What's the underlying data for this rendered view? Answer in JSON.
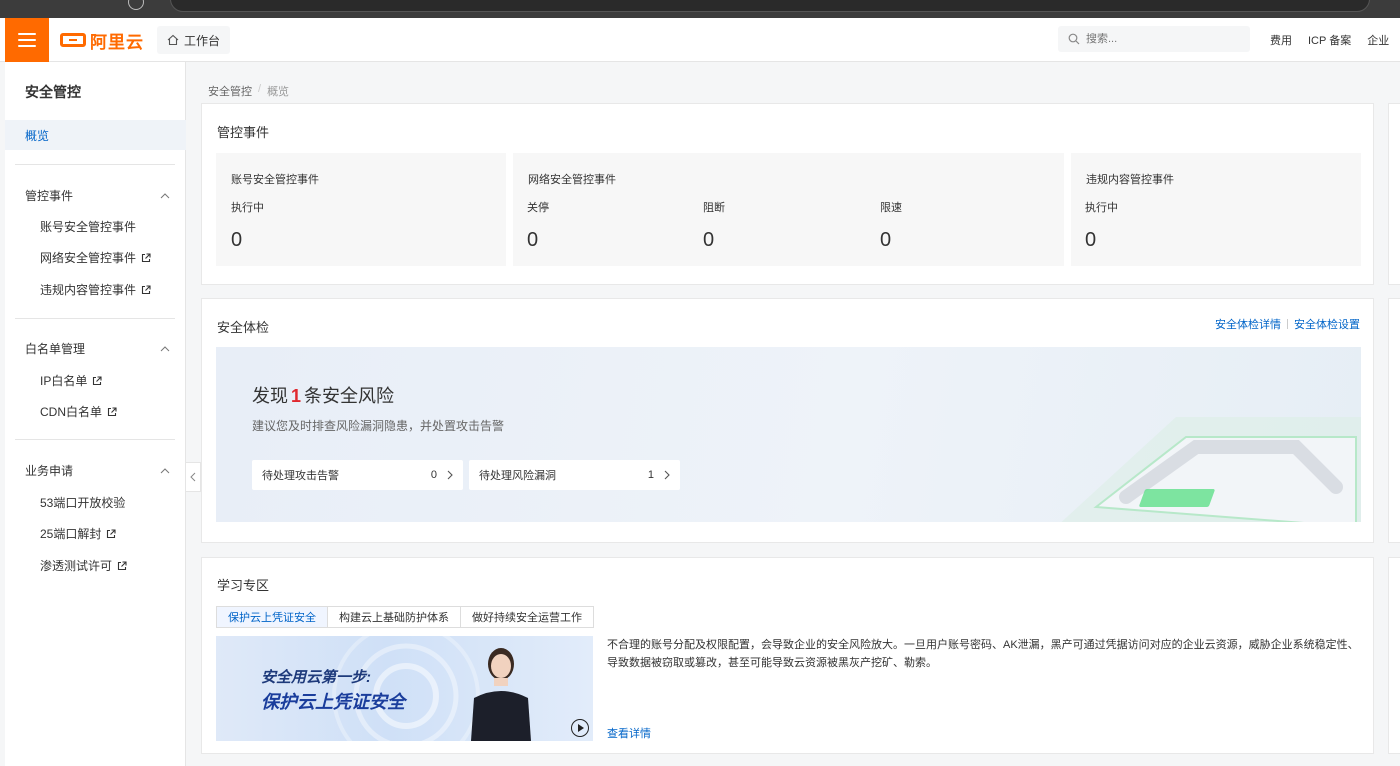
{
  "header": {
    "logo_text": "阿里云",
    "workbench": "工作台",
    "search_placeholder": "搜索...",
    "links": [
      "费用",
      "ICP 备案",
      "企业"
    ]
  },
  "sidebar": {
    "title": "安全管控",
    "active": "概览",
    "groups": [
      {
        "label": "管控事件",
        "items": [
          "账号安全管控事件",
          "网络安全管控事件",
          "违规内容管控事件"
        ]
      },
      {
        "label": "白名单管理",
        "items": [
          "IP白名单",
          "CDN白名单"
        ]
      },
      {
        "label": "业务申请",
        "items": [
          "53端口开放校验",
          "25端口解封",
          "渗透测试许可"
        ]
      }
    ]
  },
  "breadcrumb": {
    "root": "安全管控",
    "current": "概览"
  },
  "events": {
    "title": "管控事件",
    "account": {
      "title": "账号安全管控事件",
      "label": "执行中",
      "value": "0"
    },
    "network": {
      "title": "网络安全管控事件",
      "cols": [
        {
          "label": "关停",
          "value": "0"
        },
        {
          "label": "阻断",
          "value": "0"
        },
        {
          "label": "限速",
          "value": "0"
        }
      ]
    },
    "content": {
      "title": "违规内容管控事件",
      "label": "执行中",
      "value": "0"
    }
  },
  "check": {
    "title": "安全体检",
    "link_detail": "安全体检详情",
    "link_settings": "安全体检设置",
    "headline_prefix": "发现",
    "headline_count": "1",
    "headline_suffix": "条安全风险",
    "subtitle": "建议您及时排查风险漏洞隐患，并处置攻击告警",
    "pills": [
      {
        "label": "待处理攻击告警",
        "value": "0"
      },
      {
        "label": "待处理风险漏洞",
        "value": "1"
      }
    ]
  },
  "learn": {
    "title": "学习专区",
    "tabs": [
      "保护云上凭证安全",
      "构建云上基础防护体系",
      "做好持续安全运营工作"
    ],
    "video_line1": "安全用云第一步:",
    "video_line2": "保护云上凭证安全",
    "description": "不合理的账号分配及权限配置，会导致企业的安全风险放大。一旦用户账号密码、AK泄漏，黑产可通过凭据访问对应的企业云资源，威胁企业系统稳定性、导致数据被窃取或篡改，甚至可能导致云资源被黑灰产挖矿、勒索。",
    "more": "查看详情"
  },
  "colors": {
    "brand": "#ff6a00",
    "link": "#0064c8",
    "danger": "#e0282e"
  }
}
